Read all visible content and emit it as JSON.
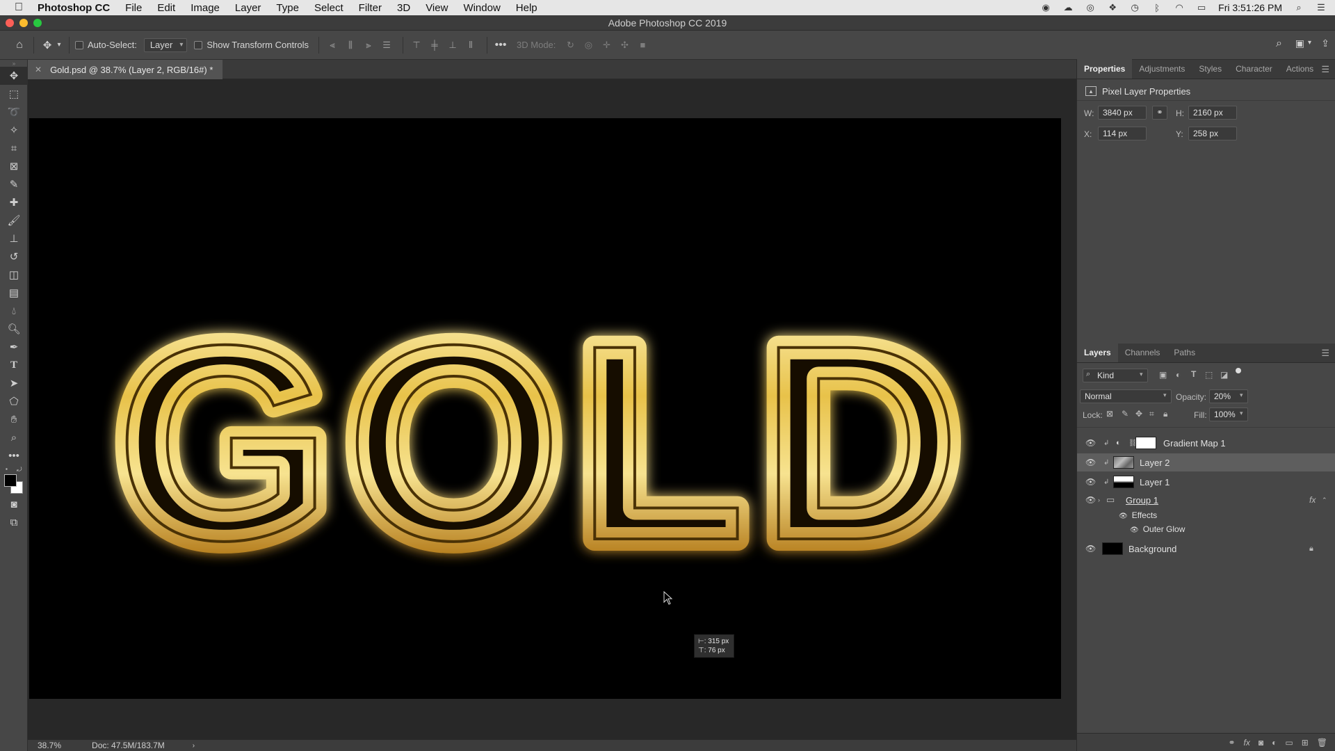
{
  "menubar": {
    "app_name": "Photoshop CC",
    "items": [
      "File",
      "Edit",
      "Image",
      "Layer",
      "Type",
      "Select",
      "Filter",
      "3D",
      "View",
      "Window",
      "Help"
    ],
    "clock": "Fri 3:51:26 PM"
  },
  "window": {
    "title": "Adobe Photoshop CC 2019"
  },
  "options_bar": {
    "auto_select_label": "Auto-Select:",
    "auto_select_value": "Layer",
    "show_transform_label": "Show Transform Controls",
    "mode_3d_label": "3D Mode:"
  },
  "document": {
    "tab_title": "Gold.psd @ 38.7% (Layer 2, RGB/16#) *",
    "canvas_text": "GOLD",
    "hud": {
      "line1": "⊢: 315 px",
      "line2": "⊤:  76 px"
    }
  },
  "status_bar": {
    "zoom": "38.7%",
    "doc_info": "Doc: 47.5M/183.7M"
  },
  "properties_panel": {
    "tabs": [
      "Properties",
      "Adjustments",
      "Styles",
      "Character",
      "Actions"
    ],
    "header": "Pixel Layer Properties",
    "w_label": "W:",
    "w_value": "3840 px",
    "h_label": "H:",
    "h_value": "2160 px",
    "x_label": "X:",
    "x_value": "114 px",
    "y_label": "Y:",
    "y_value": "258 px"
  },
  "layers_panel": {
    "tabs": [
      "Layers",
      "Channels",
      "Paths"
    ],
    "filter_value": "Kind",
    "blend_mode": "Normal",
    "opacity_label": "Opacity:",
    "opacity_value": "20%",
    "lock_label": "Lock:",
    "fill_label": "Fill:",
    "fill_value": "100%",
    "layers": [
      {
        "name": "Gradient Map 1"
      },
      {
        "name": "Layer 2",
        "selected": true
      },
      {
        "name": "Layer 1"
      },
      {
        "name": "Group 1"
      },
      {
        "name": "Background"
      }
    ],
    "effects_label": "Effects",
    "outer_glow_label": "Outer Glow",
    "fx_label": "fx"
  },
  "colors": {
    "gold_light": "#fff6c0",
    "gold_mid": "#e8c24a",
    "gold_dark": "#8a5c10",
    "canvas_bg": "#000000"
  }
}
